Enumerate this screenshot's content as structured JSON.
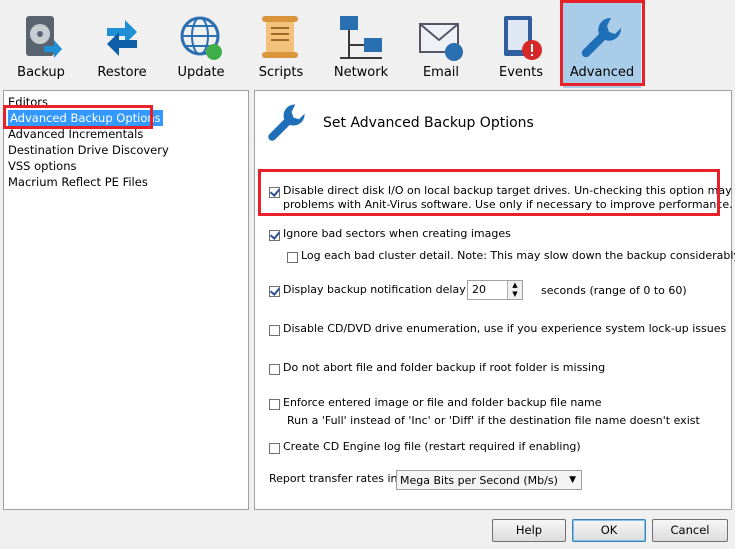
{
  "toolbar": {
    "items": [
      {
        "label": "Backup",
        "icon": "backup-icon"
      },
      {
        "label": "Restore",
        "icon": "restore-icon"
      },
      {
        "label": "Update",
        "icon": "update-globe-icon"
      },
      {
        "label": "Scripts",
        "icon": "scripts-scroll-icon"
      },
      {
        "label": "Network",
        "icon": "network-icon"
      },
      {
        "label": "Email",
        "icon": "email-icon"
      },
      {
        "label": "Events",
        "icon": "events-icon"
      },
      {
        "label": "Advanced",
        "icon": "wrench-icon",
        "active": true
      }
    ]
  },
  "tree": {
    "items": [
      {
        "label": "Editors"
      },
      {
        "label": "Advanced Backup Options",
        "selected": true
      },
      {
        "label": "Advanced Incrementals"
      },
      {
        "label": "Destination Drive Discovery"
      },
      {
        "label": "VSS options"
      },
      {
        "label": "Macrium Reflect PE Files"
      }
    ]
  },
  "panel": {
    "title": "Set Advanced Backup Options",
    "options": {
      "direct_io": {
        "checked": true,
        "line1": "Disable direct disk I/O on local backup target drives. Un-checking this option may cause",
        "line2": "problems with Anit-Virus software. Use only if necessary to improve performance."
      },
      "ignore_bad": {
        "checked": true,
        "label": "Ignore bad sectors when creating images"
      },
      "log_bad": {
        "checked": false,
        "label": "Log each bad cluster detail. Note: This may slow down the backup considerably."
      },
      "notify_delay": {
        "checked": true,
        "label": "Display backup notification delay for",
        "value": "20",
        "suffix": "seconds (range of 0 to 60)"
      },
      "cd_enum": {
        "checked": false,
        "label": "Disable CD/DVD drive enumeration, use if you experience system lock-up issues"
      },
      "no_abort": {
        "checked": false,
        "label": "Do not abort file and folder backup if root folder is missing"
      },
      "enforce_name": {
        "checked": false,
        "line1": "Enforce entered image or file and folder backup file name",
        "line2": "Run a 'Full' instead of 'Inc' or 'Diff' if the destination file name doesn't exist"
      },
      "cd_log": {
        "checked": false,
        "label": "Create CD Engine log file (restart required if enabling)"
      }
    },
    "rates": {
      "label": "Report transfer rates in:",
      "value": "Mega Bits per Second (Mb/s)"
    }
  },
  "buttons": {
    "help": "Help",
    "ok": "OK",
    "cancel": "Cancel"
  },
  "colors": {
    "highlight_red": "#e8202a",
    "selection_blue": "#3399ff",
    "active_tab": "#a9cde8"
  }
}
